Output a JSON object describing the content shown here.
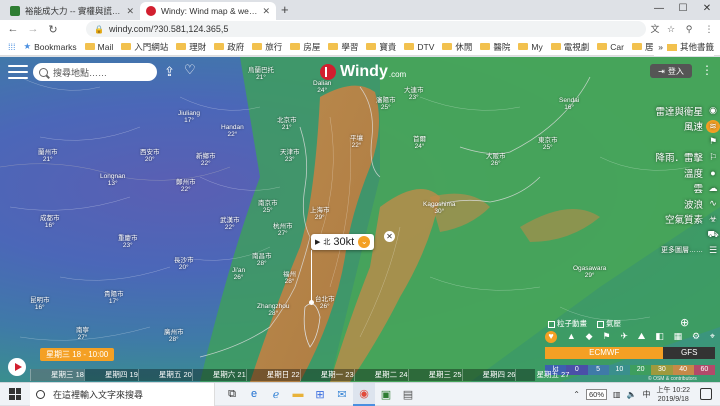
{
  "browser": {
    "tabs": [
      {
        "title": "裕能成大力 -- 實權與謊言的權人…",
        "active": false,
        "favicon_color": "#2e7d32"
      },
      {
        "title": "Windy: Wind map & weather fo",
        "active": true,
        "favicon_color": "#d21f2f"
      }
    ],
    "new_tab": "+",
    "url": "windy.com/?30.581,124.365,5",
    "bookmarks_label": "Bookmarks",
    "bookmarks": [
      "Mail",
      "入門網站",
      "理財",
      "政府",
      "旅行",
      "房屋",
      "學習",
      "寶貴",
      "DTV",
      "休閒",
      "醫院",
      "My",
      "電視劇",
      "Car",
      "居家"
    ],
    "other_bookmarks": "其他書籤"
  },
  "windy": {
    "search_placeholder": "搜尋地點……",
    "logo": "Windy",
    "logo_suffix": ".com",
    "login": "登入",
    "layers": [
      {
        "label": "雷達與衛星",
        "icon": "radar-icon",
        "active": false
      },
      {
        "label": "風速",
        "icon": "wind-icon",
        "active": true
      },
      {
        "label": "",
        "icon": "flag-icon",
        "active": false
      },
      {
        "label": "降雨．雷擊",
        "icon": "rain-icon",
        "active": false
      },
      {
        "label": "溫度",
        "icon": "thermometer-icon",
        "active": false
      },
      {
        "label": "雲",
        "icon": "cloud-icon",
        "active": false
      },
      {
        "label": "波浪",
        "icon": "wave-icon",
        "active": false
      },
      {
        "label": "空氣質素",
        "icon": "air-icon",
        "active": false
      },
      {
        "label": "",
        "icon": "car-icon",
        "active": false
      }
    ],
    "more_layers": "更多圖層……",
    "popup": {
      "direction": "北",
      "speed": "30kt"
    },
    "checkboxes": [
      "粒子動畫",
      "氣壓"
    ],
    "models": {
      "ecmwf": "ECMWF",
      "gfs": "GFS"
    },
    "scale": {
      "unit": "kt",
      "values": [
        "0",
        "5",
        "10",
        "20",
        "30",
        "40",
        "60"
      ]
    },
    "copyright": "© OSM & contributors",
    "time_bubble": "星期三 18 - 10:00",
    "timeline_days": [
      "星期三 18",
      "星期四 19",
      "星期五 20",
      "星期六 21",
      "星期日 22",
      "星期一 23",
      "星期二 24",
      "星期三 25",
      "星期四 26",
      "星期五 27"
    ],
    "places": [
      {
        "name": "烏蘭巴托",
        "temp": "21°"
      },
      {
        "name": "北京市",
        "temp": "21°"
      },
      {
        "name": "大連市",
        "temp": "23°"
      },
      {
        "name": "瀋陽市",
        "temp": "25°"
      },
      {
        "name": "Dalian",
        "temp": "24°"
      },
      {
        "name": "首爾",
        "temp": "24°"
      },
      {
        "name": "平壤",
        "temp": "22°"
      },
      {
        "name": "天津市",
        "temp": "23°"
      },
      {
        "name": "Handan",
        "temp": "22°"
      },
      {
        "name": "Jiuliang",
        "temp": "17°"
      },
      {
        "name": "Sendai",
        "temp": "16°"
      },
      {
        "name": "Kagoshima",
        "temp": "30°"
      },
      {
        "name": "東京市",
        "temp": "25°"
      },
      {
        "name": "大阪市",
        "temp": "26°"
      },
      {
        "name": "上海市",
        "temp": "29°"
      },
      {
        "name": "南京市",
        "temp": "25°"
      },
      {
        "name": "杭州市",
        "temp": "27°"
      },
      {
        "name": "武漢市",
        "temp": "22°"
      },
      {
        "name": "長沙市",
        "temp": "20°"
      },
      {
        "name": "南昌市",
        "temp": "28°"
      },
      {
        "name": "福州",
        "temp": "28°"
      },
      {
        "name": "Zhangzhou",
        "temp": "28°"
      },
      {
        "name": "台北市",
        "temp": "26°"
      },
      {
        "name": "重慶市",
        "temp": "23°"
      },
      {
        "name": "成都市",
        "temp": "16°"
      },
      {
        "name": "貴陽市",
        "temp": "17°"
      },
      {
        "name": "昆明市",
        "temp": "16°"
      },
      {
        "name": "Longnan",
        "temp": "13°"
      },
      {
        "name": "蘭州市",
        "temp": "21°"
      },
      {
        "name": "西安市",
        "temp": "20°"
      },
      {
        "name": "新鄉市",
        "temp": "22°"
      },
      {
        "name": "鄭州市",
        "temp": "22°"
      },
      {
        "name": "Ji'an",
        "temp": "26°"
      },
      {
        "name": "Ogasawara",
        "temp": "29°"
      },
      {
        "name": "廣州市",
        "temp": "28°"
      },
      {
        "name": "南寧",
        "temp": "27°"
      }
    ]
  },
  "taskbar": {
    "search_placeholder": "在這裡輸入文字來搜尋",
    "battery": "60%",
    "time": "上午 10:22",
    "date": "2019/9/18"
  },
  "colors": {
    "accent": "#f4a024",
    "windy_red": "#d21f2f"
  }
}
